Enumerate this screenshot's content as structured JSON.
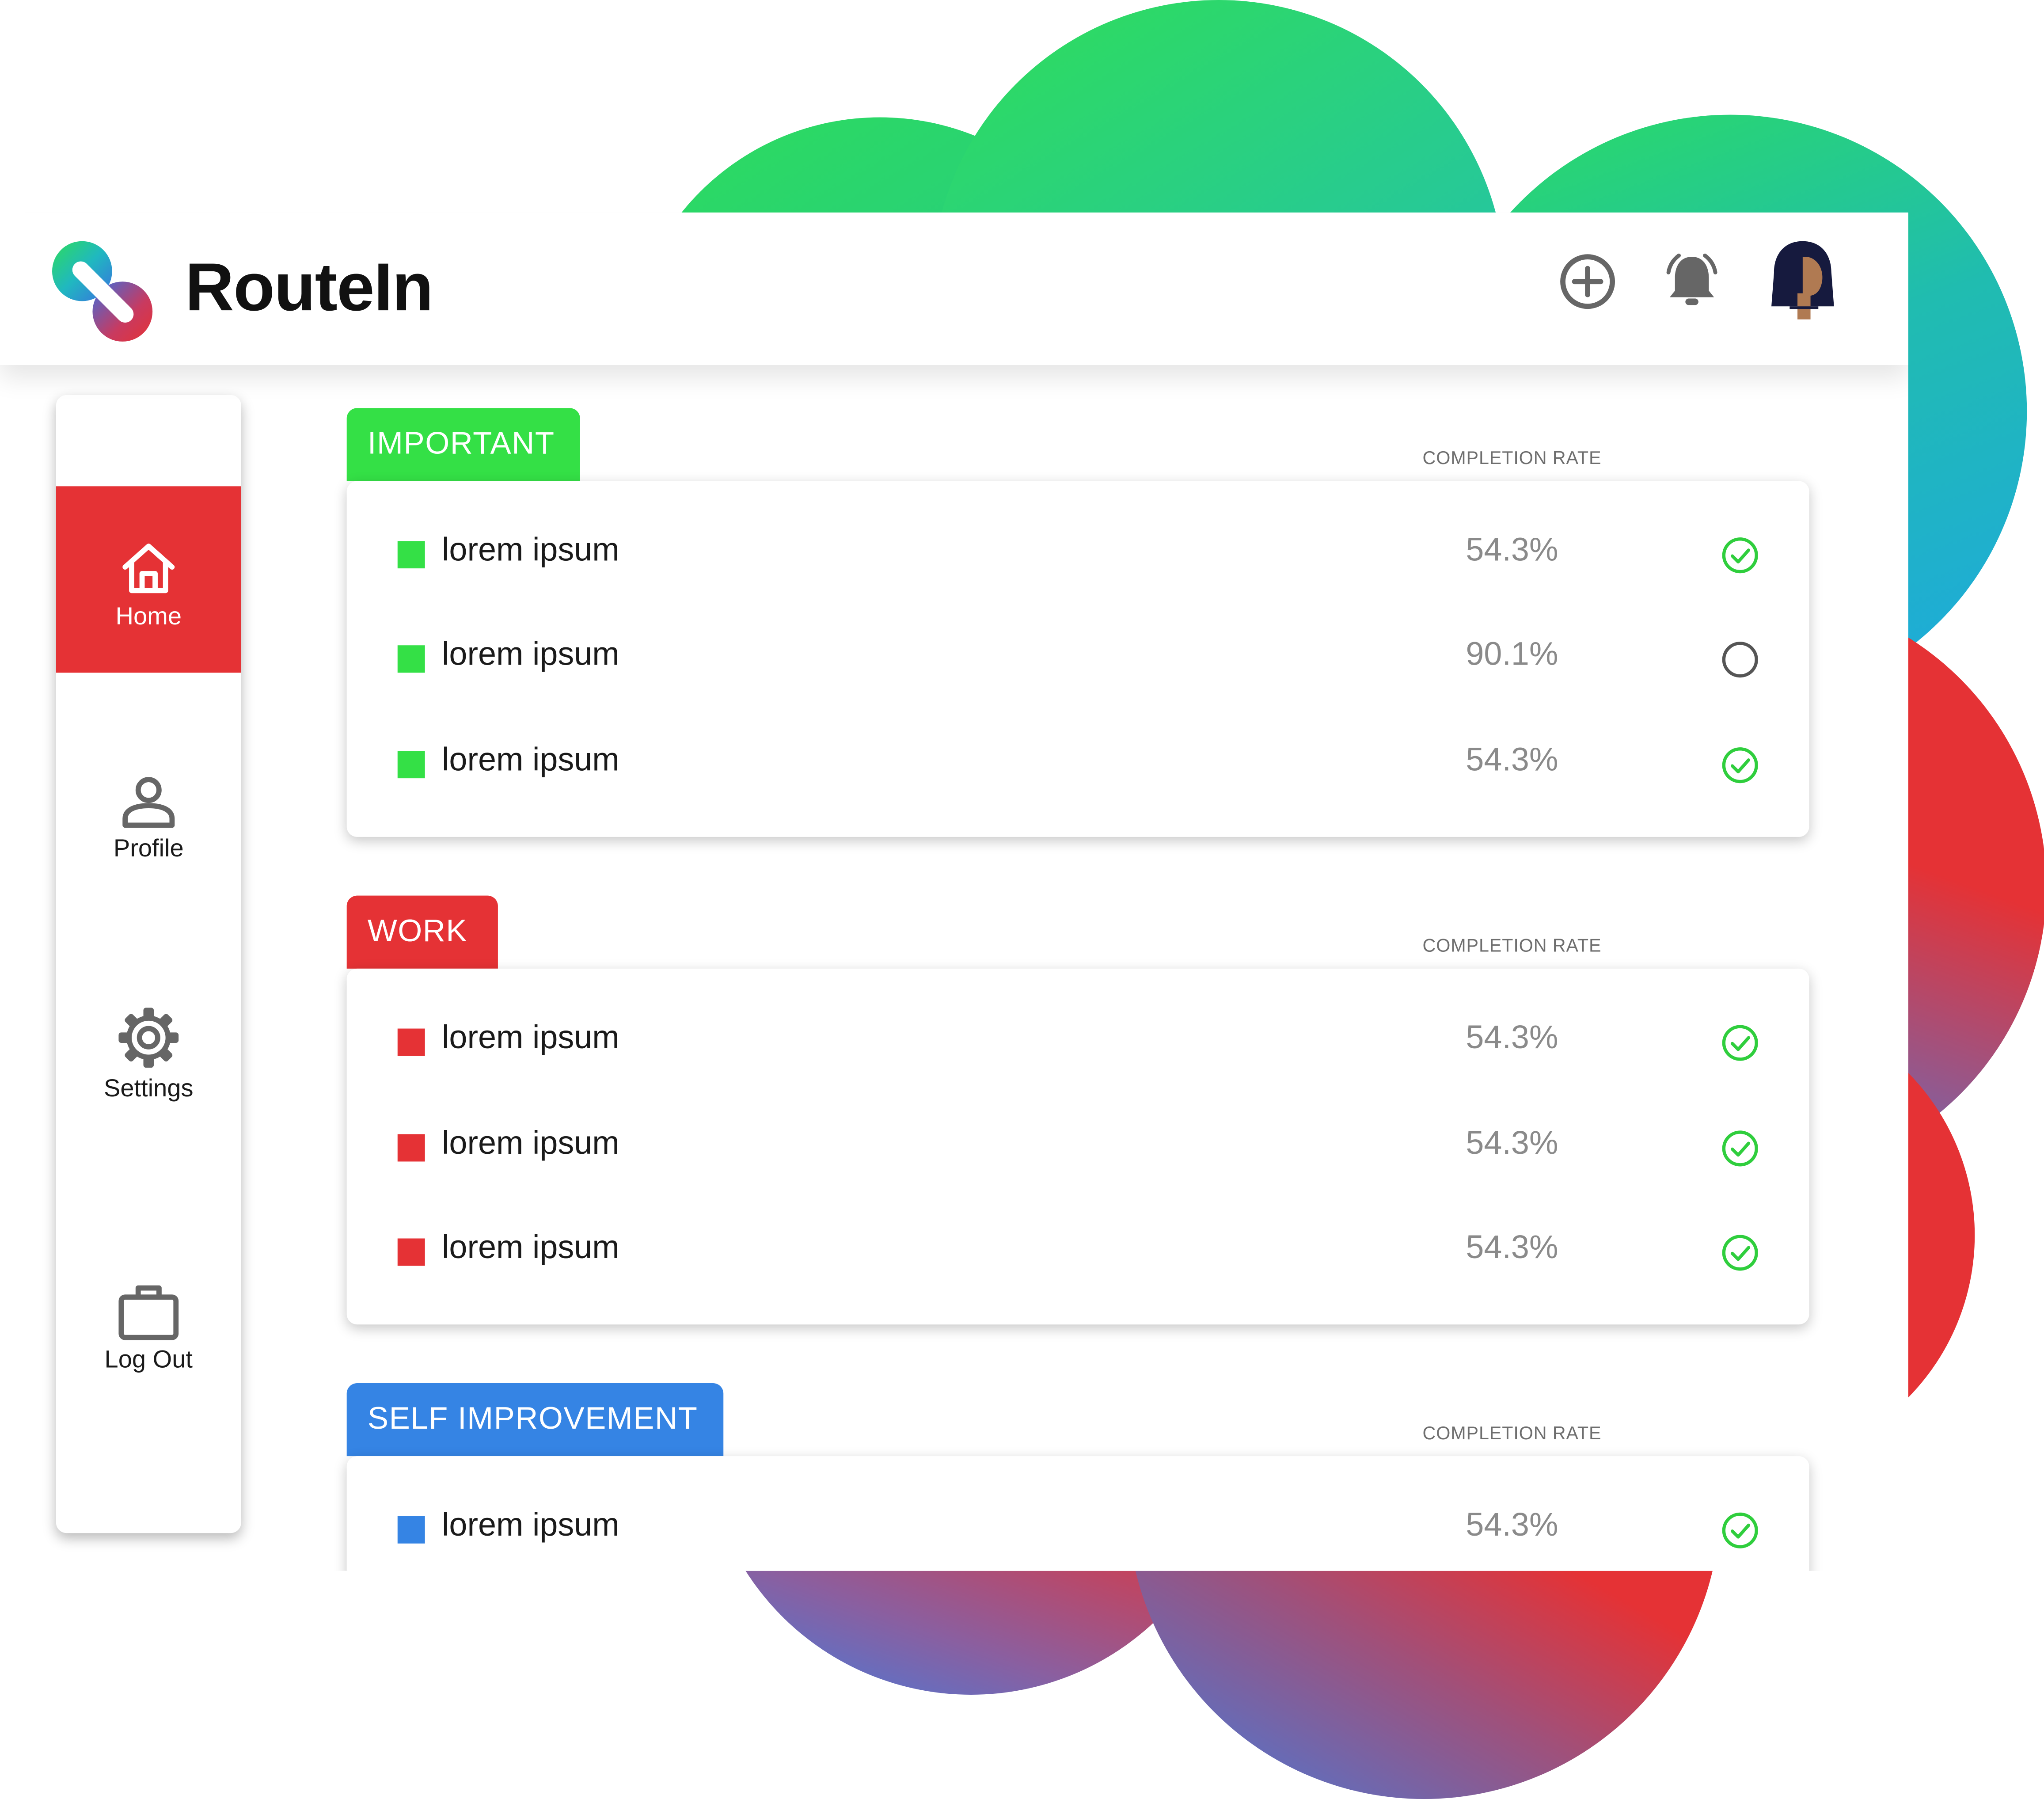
{
  "app": {
    "brand": "RouteIn"
  },
  "colors": {
    "green": "#34e046",
    "red": "#e53235",
    "blue": "#3584e4",
    "check": "#2fce3d",
    "icon_gray": "#666666"
  },
  "header": {
    "icons": [
      "add-circle-icon",
      "bell-ringing-icon",
      "user-avatar"
    ]
  },
  "sidebar": {
    "items": [
      {
        "label": "Home",
        "icon": "home-icon",
        "active": true
      },
      {
        "label": "Profile",
        "icon": "user-icon",
        "active": false
      },
      {
        "label": "Settings",
        "icon": "gear-icon",
        "active": false
      },
      {
        "label": "Log Out",
        "icon": "briefcase-icon",
        "active": false
      }
    ]
  },
  "sections": [
    {
      "title": "IMPORTANT",
      "rate_label": "COMPLETION RATE",
      "rows": [
        {
          "text": "lorem ipsum",
          "rate": "54.3%",
          "done": true
        },
        {
          "text": "lorem ipsum",
          "rate": "90.1%",
          "done": false
        },
        {
          "text": "lorem ipsum",
          "rate": "54.3%",
          "done": true
        }
      ]
    },
    {
      "title": "WORK",
      "rate_label": "COMPLETION RATE",
      "rows": [
        {
          "text": "lorem ipsum",
          "rate": "54.3%",
          "done": true
        },
        {
          "text": "lorem ipsum",
          "rate": "54.3%",
          "done": true
        },
        {
          "text": "lorem ipsum",
          "rate": "54.3%",
          "done": true
        }
      ]
    },
    {
      "title": "SELF IMPROVEMENT",
      "rate_label": "COMPLETION RATE",
      "rows": [
        {
          "text": "lorem ipsum",
          "rate": "54.3%",
          "done": true
        }
      ]
    }
  ]
}
